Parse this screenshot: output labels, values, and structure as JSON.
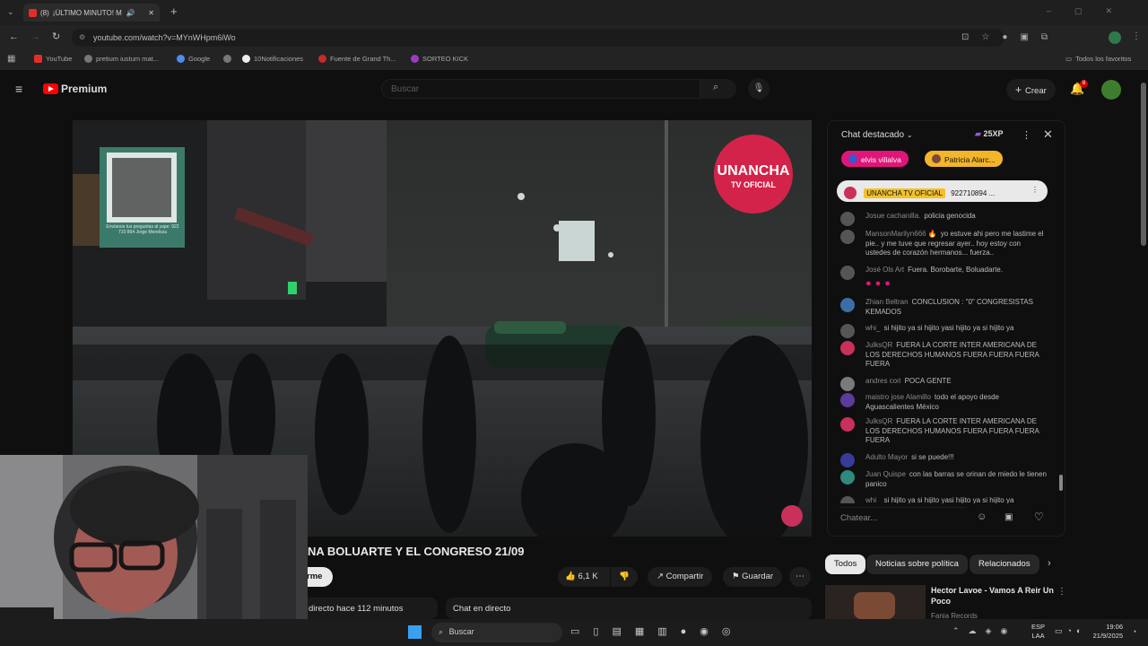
{
  "browser": {
    "tab_count": "(8)",
    "tab_title": "¡ÚLTIMO MINUTO! M",
    "url": "youtube.com/watch?v=MYnWHpm6iWo",
    "bookmarks": [
      "YouTube",
      "pretium iustum mat...",
      "Google",
      "",
      "10Notificaciones",
      "Fuente de Grand Th...",
      "SORTEO KICK"
    ],
    "all_favorites": "Todos los favoritos"
  },
  "youtube": {
    "logo": "Premium",
    "logo_region": "PE",
    "search_placeholder": "Buscar",
    "create_label": "Crear",
    "notif_count": "8"
  },
  "video": {
    "watermark_line1": "UNANCHA",
    "watermark_line2": "TV OFICIAL",
    "qr_caption": "Envíanos tus preguntas al yape: 922 710 894 Jorge Mendoza",
    "title": "NA BOLUARTE Y EL CONGRESO 21/09",
    "subscribe_label": "rme",
    "likes": "6,1 K",
    "share_label": "Compartir",
    "save_label": "Guardar",
    "live_info": "directo hace 112 minutos",
    "live_chat_label": "Chat en directo"
  },
  "chat": {
    "header": "Chat destacado",
    "xp": "25XP",
    "chips": [
      "elvis villalva",
      "Patricia Alarc..."
    ],
    "pinned_author": "UNANCHA TV OFICIAL",
    "pinned_text": "922710894 ...",
    "messages": [
      {
        "author": "Josue cachanilla.",
        "text": "policia genocida"
      },
      {
        "author": "MansonMarilyn666 🔥",
        "text": "yo estuve ahi pero me lastime el pie.. y me tuve que regresar ayer.. hoy estoy con ustedes de corazón hermanos... fuerza.."
      },
      {
        "author": "José Ols Art",
        "text": "Fuera. Borobarte, Boluadarte."
      },
      {
        "author": "Zhian Beltran",
        "text": "CONCLUSION : \"0\" CONGRESISTAS KEMADOS"
      },
      {
        "author": "whi_",
        "text": "si hijito ya si hijito yasi hijito ya si hijito ya"
      },
      {
        "author": "JulksQR",
        "text": "FUERA LA CORTE INTER AMERICANA DE LOS DERECHOS HUMANOS FUERA FUERA FUERA FUERA"
      },
      {
        "author": "andres cori",
        "text": "POCA GENTE"
      },
      {
        "author": "maistro jose Alamillo",
        "text": "todo el apoyo desde Aguascalientes México"
      },
      {
        "author": "JulksQR",
        "text": "FUERA LA CORTE INTER AMERICANA DE LOS DERECHOS HUMANOS FUERA FUERA FUERA FUERA"
      },
      {
        "author": "Adulto Mayor",
        "text": "si se puede!!!"
      },
      {
        "author": "Juan Quispe",
        "text": "con las barras se orinan de miedo le tienen panico"
      },
      {
        "author": "whi_",
        "text": "si hijito ya si hijito yasi hijito ya si hijito ya"
      }
    ],
    "input_placeholder": "Chatear..."
  },
  "related": {
    "tabs": [
      "Todos",
      "Noticias sobre política",
      "Relacionados"
    ],
    "item_title": "Hector Lavoe - Vamos A Reir Un Poco",
    "item_channel": "Fania Records"
  },
  "taskbar": {
    "search": "Buscar",
    "lang": "ESP",
    "lang2": "LAA",
    "time": "19:06",
    "date": "21/9/2025"
  },
  "colors": {
    "accent": "#ff0000",
    "chip1": "#e0157a",
    "chip2": "#f3b52a"
  }
}
